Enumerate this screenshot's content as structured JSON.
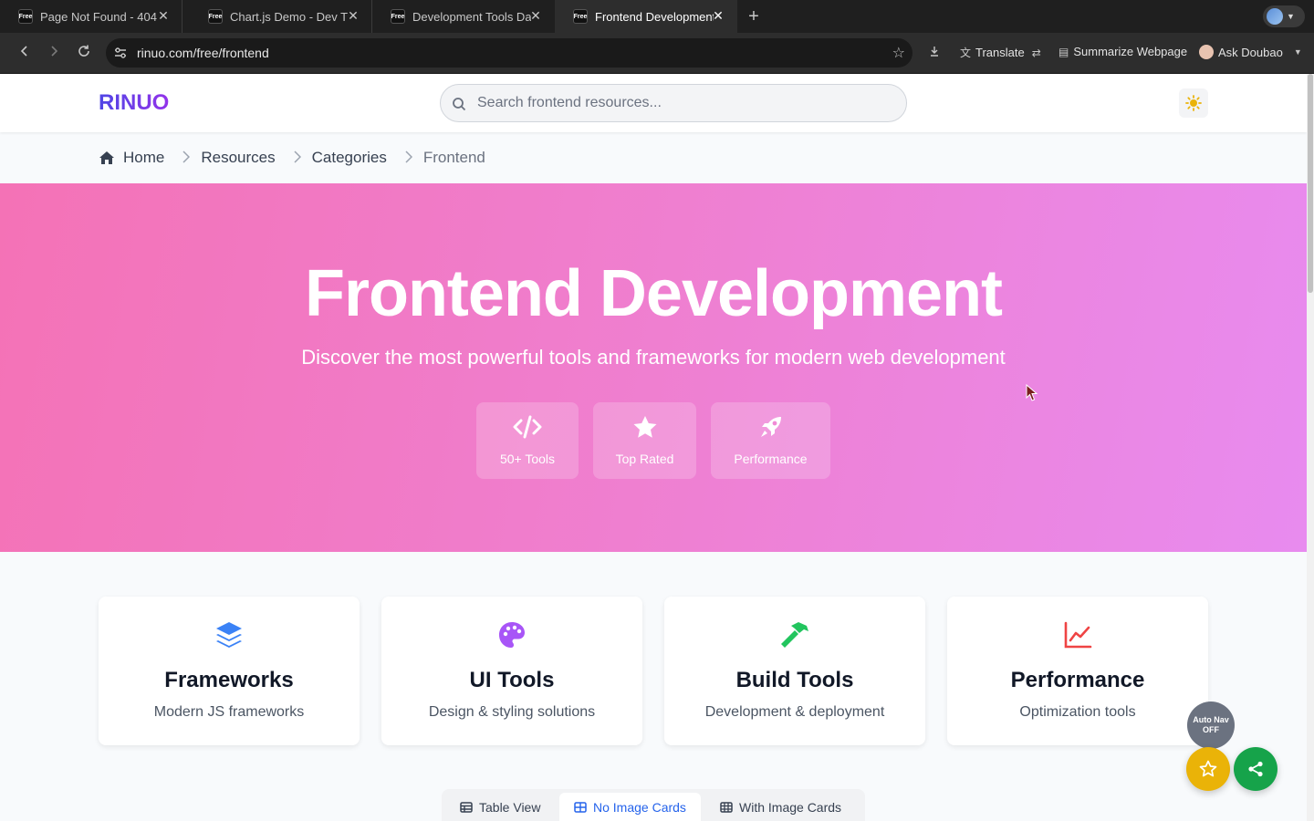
{
  "browser": {
    "tabs": [
      {
        "label": "Page Not Found - 404",
        "favicon": "Free"
      },
      {
        "label": "Chart.js Demo - Dev T",
        "favicon": "Free"
      },
      {
        "label": "Development Tools Da",
        "favicon": "Free"
      },
      {
        "label": "Frontend Development",
        "favicon": "Free"
      }
    ],
    "url": "rinuo.com/free/frontend",
    "toolbar": {
      "translate": "Translate",
      "summarize": "Summarize Webpage",
      "ask": "Ask Doubao"
    }
  },
  "header": {
    "logo": "RINUO",
    "search_placeholder": "Search frontend resources...",
    "theme_icon": "sun-icon"
  },
  "breadcrumb": {
    "items": [
      "Home",
      "Resources",
      "Categories",
      "Frontend"
    ]
  },
  "hero": {
    "title": "Frontend Development",
    "subtitle": "Discover the most powerful tools and frameworks for modern web development",
    "badges": [
      {
        "label": "50+ Tools",
        "icon": "code-icon"
      },
      {
        "label": "Top Rated",
        "icon": "star-icon"
      },
      {
        "label": "Performance",
        "icon": "rocket-icon"
      }
    ]
  },
  "categories": [
    {
      "title": "Frameworks",
      "desc": "Modern JS frameworks",
      "icon": "layers-icon",
      "color": "#3b82f6"
    },
    {
      "title": "UI Tools",
      "desc": "Design & styling solutions",
      "icon": "palette-icon",
      "color": "#a855f7"
    },
    {
      "title": "Build Tools",
      "desc": "Development & deployment",
      "icon": "hammer-icon",
      "color": "#22c55e"
    },
    {
      "title": "Performance",
      "desc": "Optimization tools",
      "icon": "chart-line-icon",
      "color": "#ef4444"
    }
  ],
  "view_tabs": [
    "Table View",
    "No Image Cards",
    "With Image Cards"
  ],
  "view_tabs_active": 1,
  "floating": {
    "auto_nav_line1": "Auto Nav",
    "auto_nav_line2": "OFF",
    "favorite_color": "#eab308",
    "share_color": "#16a34a"
  }
}
